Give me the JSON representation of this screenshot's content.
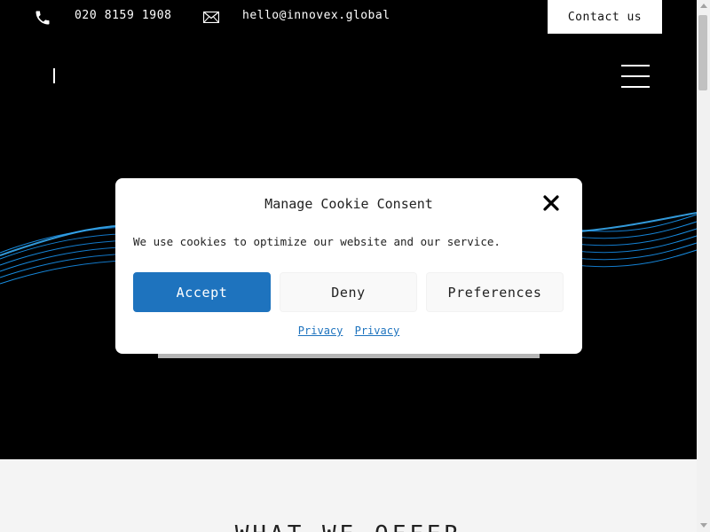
{
  "topbar": {
    "phone": "020 8159 1908",
    "email": "hello@innovex.global",
    "contact_label": "Contact us",
    "phone_icon": "phone-icon",
    "mail_icon": "mail-icon"
  },
  "nav": {
    "menu_icon": "hamburger-menu-icon"
  },
  "cookie_modal": {
    "title": "Manage Cookie Consent",
    "message": "We use cookies to optimize our website and our service.",
    "accept_label": "Accept",
    "deny_label": "Deny",
    "preferences_label": "Preferences",
    "links": [
      "Privacy",
      "Privacy"
    ],
    "close_icon": "close-icon"
  },
  "offer": {
    "title": "WHAT WE OFFER"
  },
  "colors": {
    "accent": "#1e73be",
    "hero_bg": "#000000",
    "wave": "#1aa0ff",
    "section_bg": "#f4f4f4"
  }
}
